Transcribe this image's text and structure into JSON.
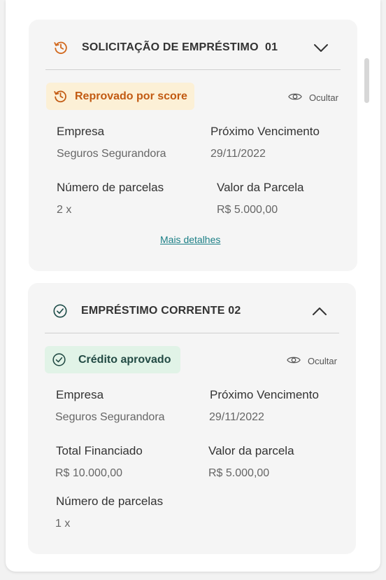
{
  "loan_request": {
    "title": "SOLICITAÇÃO DE EMPRÉSTIMO  01",
    "status": "Reprovado por score",
    "hide_label": "Ocultar",
    "fields": {
      "company_label": "Empresa",
      "company_value": "Seguros Segurandora",
      "next_due_label": "Próximo Vencimento",
      "next_due_value": "29/11/2022",
      "installments_label": "Número de parcelas",
      "installments_value": "2 x",
      "installment_value_label": "Valor da Parcela",
      "installment_value_value": "R$ 5.000,00"
    },
    "more_details": "Mais detalhes"
  },
  "current_loan": {
    "title": "EMPRÉSTIMO CORRENTE 02",
    "status": "Crédito aprovado",
    "hide_label": "Ocultar",
    "fields": {
      "company_label": "Empresa",
      "company_value": "Seguros Segurandora",
      "next_due_label": "Próximo Vencimento",
      "next_due_value": "29/11/2022",
      "total_financed_label": "Total Financiado",
      "total_financed_value": "R$ 10.000,00",
      "installment_value_label": "Valor da parcela",
      "installment_value_value": "R$ 5.000,00",
      "installments_label": "Número de parcelas",
      "installments_value": "1 x"
    }
  },
  "icons": {
    "request_header": "clock-history-icon",
    "request_status": "clock-history-icon",
    "current_header": "check-circle-icon",
    "current_status": "check-circle-icon",
    "hide": "eye-icon",
    "collapse": "chevron-down-icon",
    "expand": "chevron-up-icon"
  },
  "colors": {
    "warning_text": "#c25a12",
    "warning_bg": "#fcf0d6",
    "success_text": "#234b45",
    "success_bg": "#e1f3e7",
    "link": "#1c7f86"
  }
}
